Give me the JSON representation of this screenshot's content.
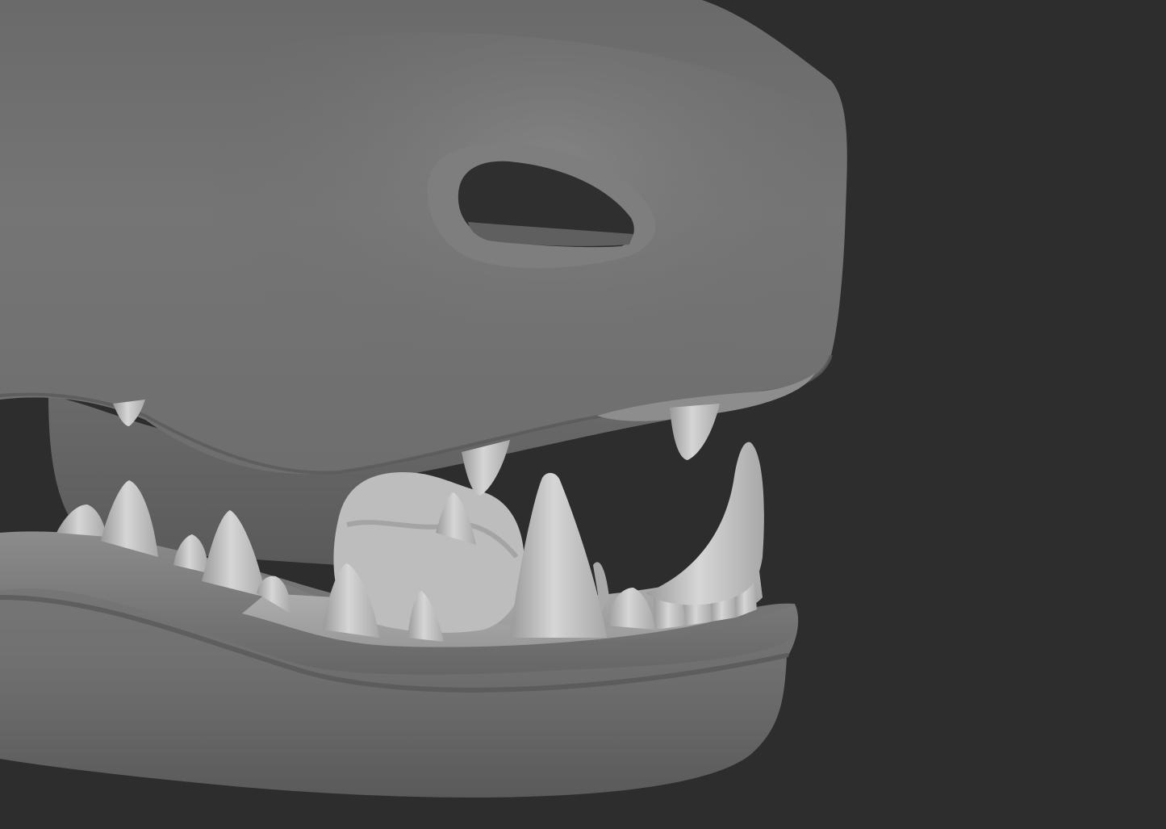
{
  "viewport": {
    "background": "#2d2d2d",
    "subject": "sculpted-creature-head-render"
  },
  "palette": {
    "skin_light": "#8a8a8a",
    "skin_mid": "#6b6b6b",
    "skin_dark": "#4a4a4a",
    "mouth_cavity": "#3e3e3e",
    "gum": "#7c7c7c",
    "tooth_light": "#d4d4d4",
    "tooth_mid": "#b3b3b3",
    "tooth_dark": "#8f8f8f"
  }
}
